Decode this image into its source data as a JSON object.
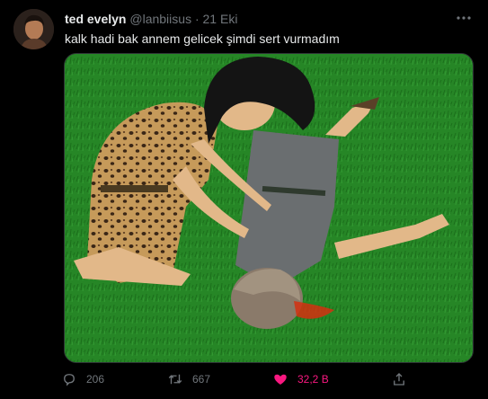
{
  "tweet": {
    "display_name": "ted evelyn",
    "handle": "@lanbiisus",
    "separator": "·",
    "date": "21 Eki",
    "text": "kalk hadi bak annem gelicek şimdi sert vurmadım",
    "more_icon": "more-dots-icon",
    "media_description_icon": "cartoon-image"
  },
  "actions": {
    "replies": "206",
    "retweets": "667",
    "likes": "32,2 B",
    "reply_icon": "reply-icon",
    "retweet_icon": "retweet-icon",
    "like_icon": "heart-filled-icon",
    "share_icon": "share-icon"
  },
  "colors": {
    "background": "#000000",
    "text": "#e7e9ea",
    "muted": "#71767b",
    "like": "#f91880"
  }
}
